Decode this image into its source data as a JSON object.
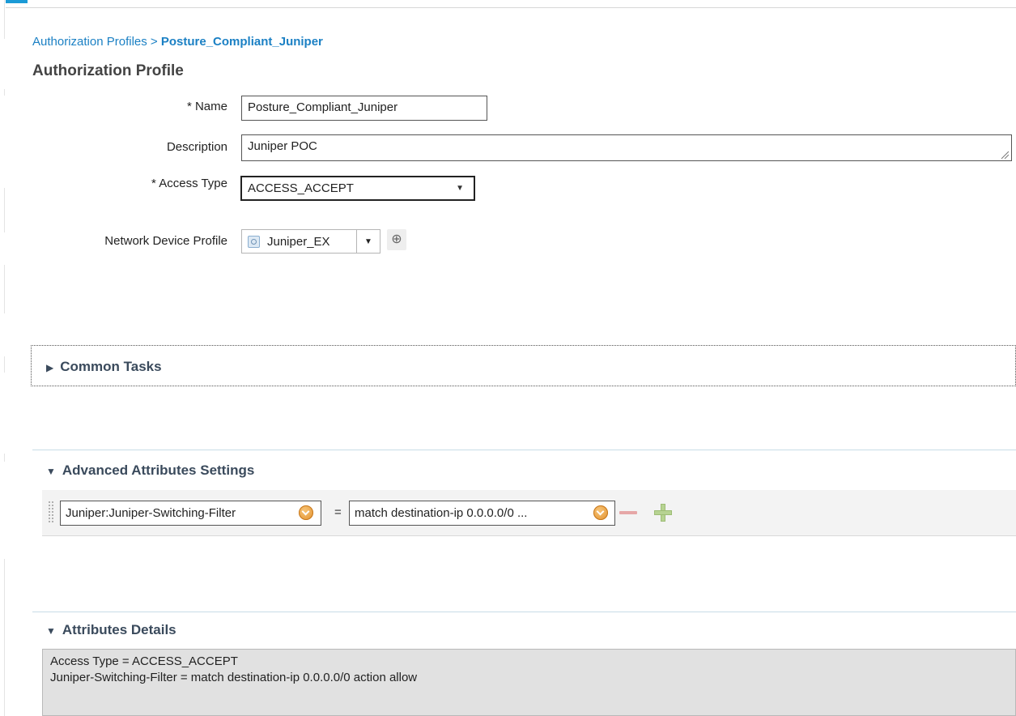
{
  "breadcrumb": {
    "parent": "Authorization Profiles",
    "separator": ">",
    "current": "Posture_Compliant_Juniper"
  },
  "page": {
    "title": "Authorization Profile"
  },
  "form": {
    "name": {
      "label": "* Name",
      "value": "Posture_Compliant_Juniper"
    },
    "description": {
      "label": "Description",
      "value": "Juniper POC"
    },
    "access_type": {
      "label": "* Access Type",
      "value": "ACCESS_ACCEPT"
    },
    "network_device_profile": {
      "label": "Network Device Profile",
      "value": "Juniper_EX"
    }
  },
  "sections": {
    "common_tasks": {
      "title": "Common Tasks",
      "expanded": false
    },
    "advanced": {
      "title": "Advanced Attributes Settings",
      "expanded": true,
      "rows": [
        {
          "attribute": "Juniper:Juniper-Switching-Filter",
          "operator": "=",
          "value": "match destination-ip 0.0.0.0/0 ..."
        }
      ]
    },
    "details": {
      "title": "Attributes Details",
      "expanded": true,
      "lines": [
        "Access Type = ACCESS_ACCEPT",
        "Juniper-Switching-Filter = match destination-ip 0.0.0.0/0 action allow"
      ]
    }
  },
  "colors": {
    "accent": "#1b9ad6",
    "link": "#1b80c4",
    "section_title": "#3a4a5c",
    "details_bg": "#e1e1e1"
  },
  "icons": [
    "network-device-icon",
    "add-circle-icon",
    "dropdown-orb-icon",
    "remove-icon",
    "add-icon",
    "expand-triangle-icon",
    "collapse-triangle-icon",
    "drag-handle-icon",
    "resize-grip-icon"
  ]
}
